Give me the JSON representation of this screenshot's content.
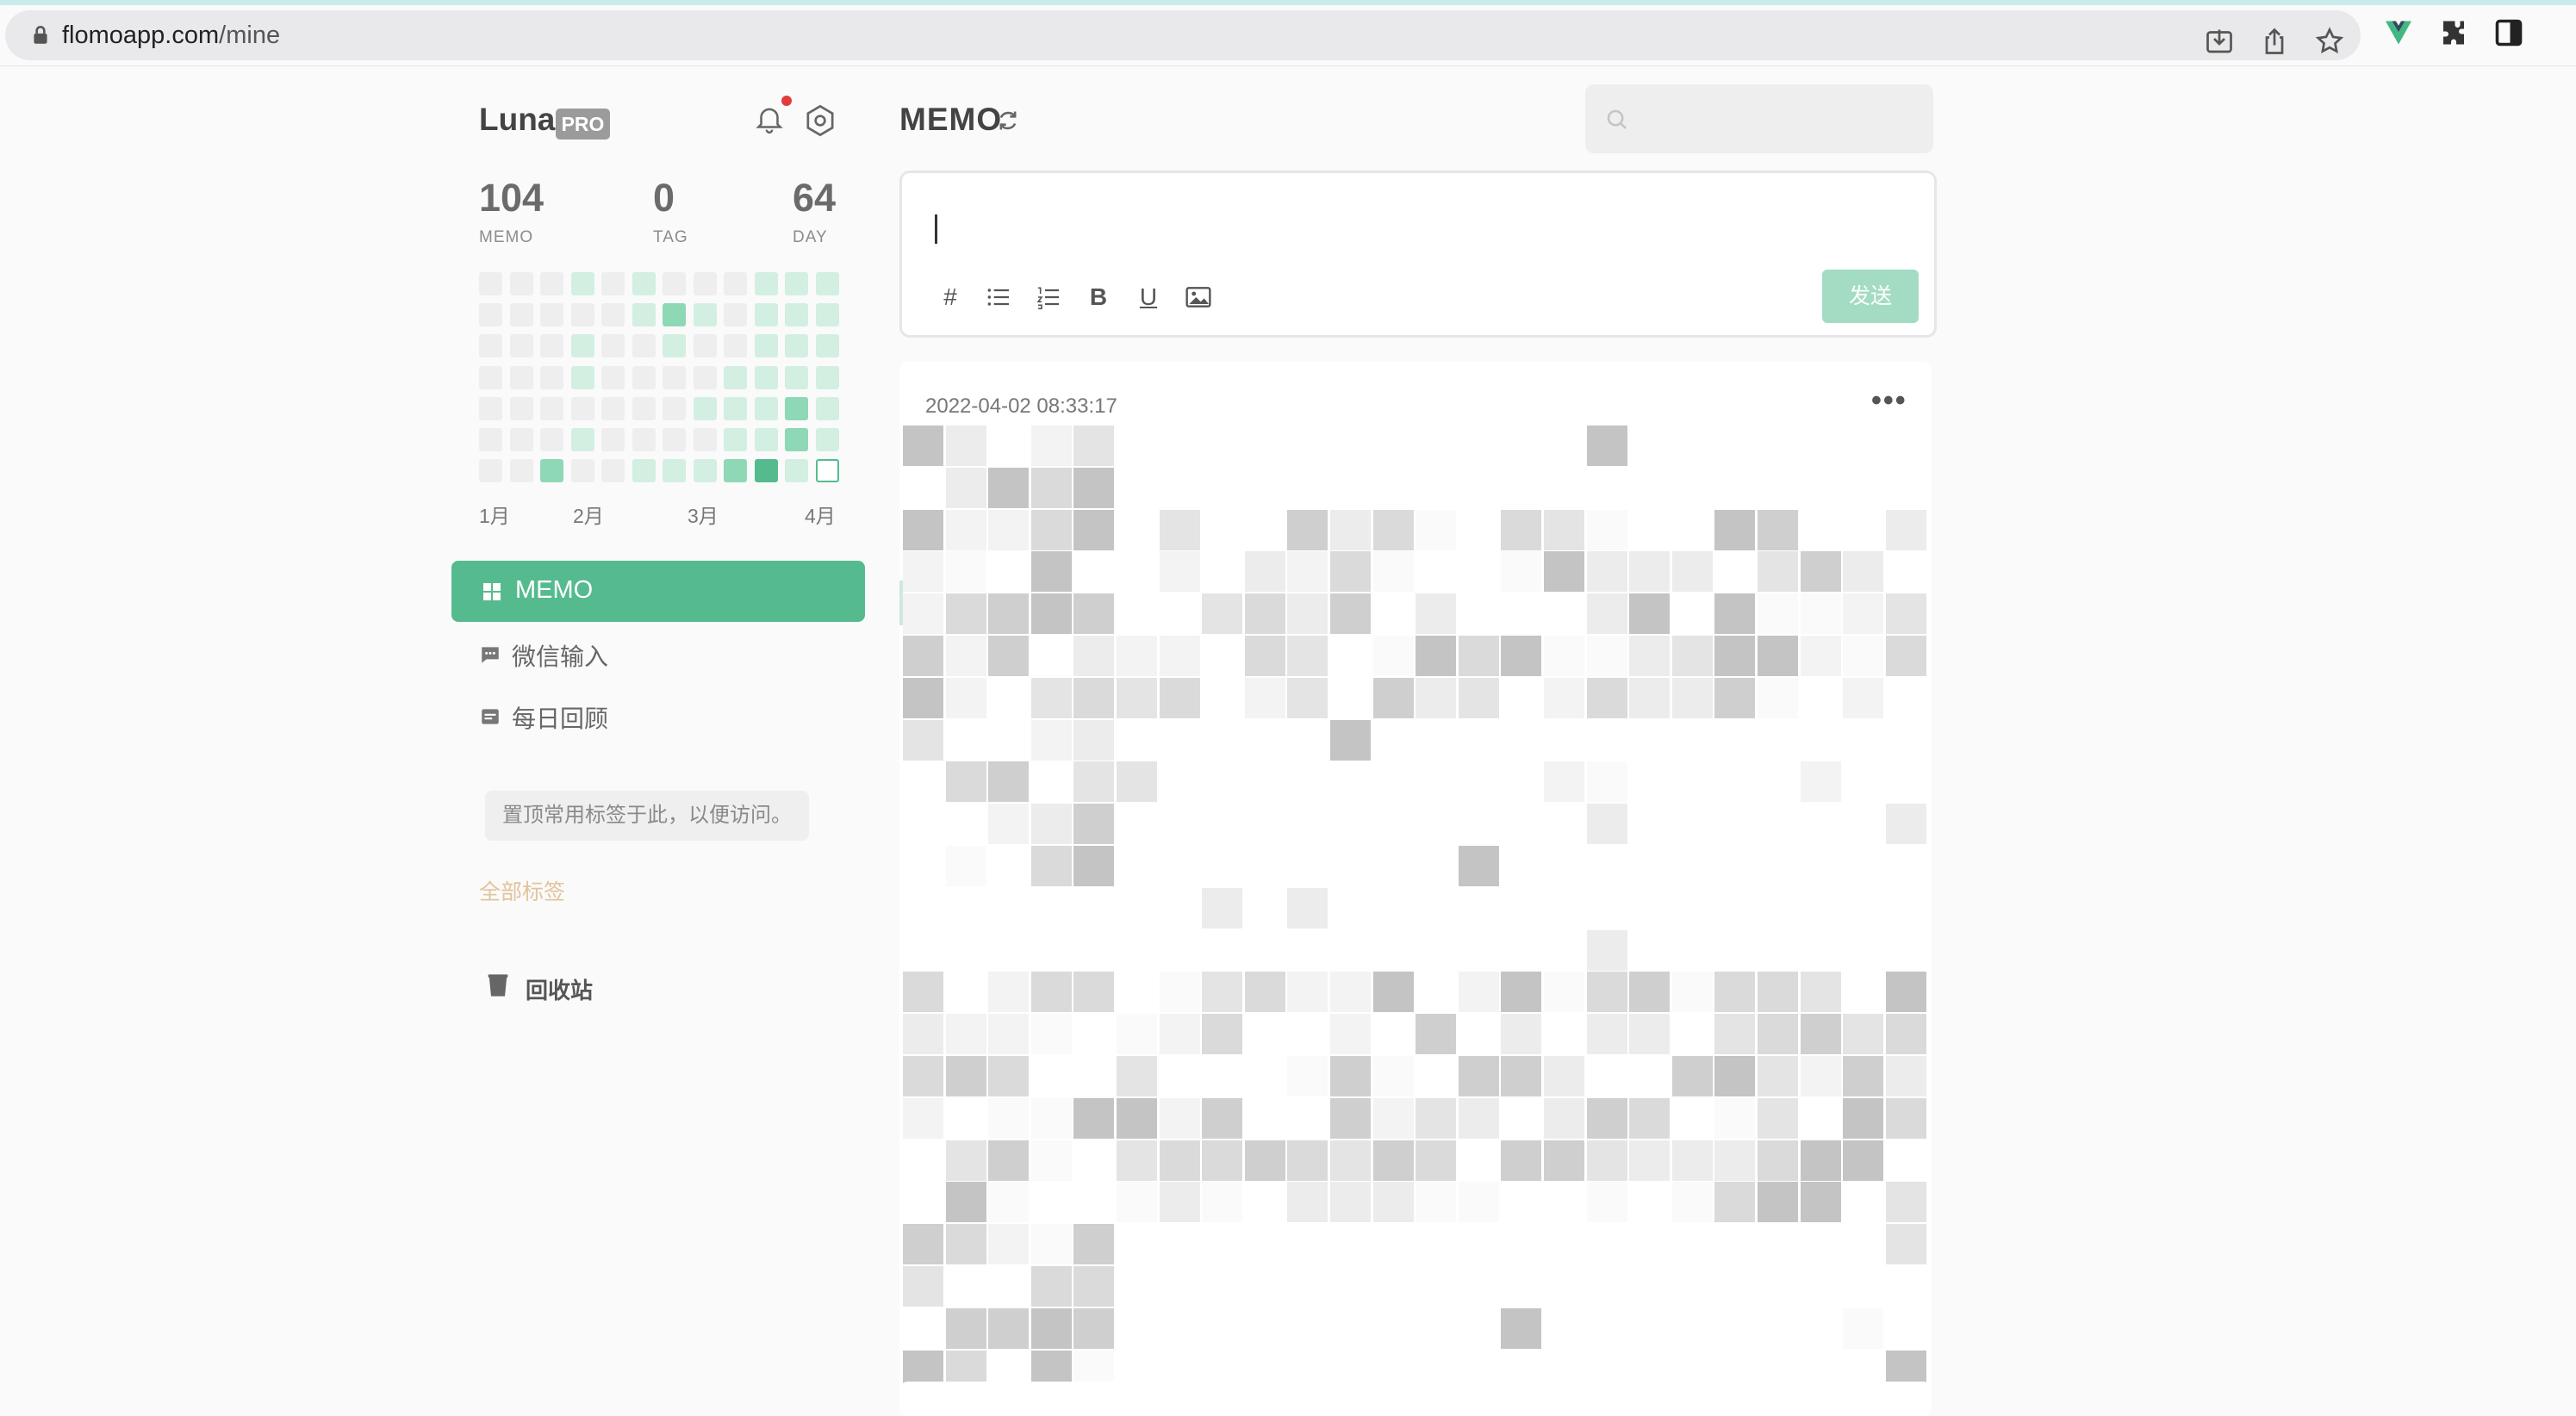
{
  "browser": {
    "url_host": "flomoapp.com",
    "url_path": "/mine",
    "icons": [
      "lock-icon",
      "install-icon",
      "share-icon",
      "bookmark-star-icon",
      "vue-devtools-icon",
      "extensions-puzzle-icon",
      "sidepanel-icon"
    ]
  },
  "sidebar": {
    "username": "Luna",
    "badge": "PRO",
    "stats": [
      {
        "value": "104",
        "label": "MEMO"
      },
      {
        "value": "0",
        "label": "TAG"
      },
      {
        "value": "64",
        "label": "DAY"
      }
    ],
    "heatmap": {
      "columns": 12,
      "rows": 7,
      "levels": [
        [
          0,
          0,
          0,
          1,
          0,
          1,
          0,
          0,
          0,
          1,
          1,
          1
        ],
        [
          0,
          0,
          0,
          0,
          0,
          1,
          2,
          1,
          0,
          1,
          1,
          1
        ],
        [
          0,
          0,
          0,
          1,
          0,
          0,
          1,
          0,
          0,
          1,
          1,
          1
        ],
        [
          0,
          0,
          0,
          1,
          0,
          0,
          0,
          0,
          1,
          1,
          1,
          1
        ],
        [
          0,
          0,
          0,
          0,
          0,
          0,
          0,
          1,
          1,
          1,
          2,
          1
        ],
        [
          0,
          0,
          0,
          1,
          0,
          0,
          0,
          0,
          1,
          1,
          2,
          1
        ],
        [
          0,
          0,
          2,
          0,
          0,
          1,
          1,
          1,
          2,
          3,
          1,
          -1
        ]
      ],
      "colors": {
        "empty": "#eeeeee",
        "l1": "#d3efe2",
        "l2": "#8fd8b5",
        "l3": "#55bb8e"
      }
    },
    "months": [
      "1月",
      "2月",
      "3月",
      "4月"
    ],
    "nav": {
      "memo": "MEMO",
      "wechat": "微信输入",
      "daily": "每日回顾"
    },
    "tag_hint": "置顶常用标签于此，以便访问。",
    "all_tags": "全部标签",
    "trash": "回收站"
  },
  "main": {
    "title": "MEMO",
    "search": {
      "placeholder": "",
      "value": ""
    },
    "editor": {
      "value": "",
      "tools": [
        "#",
        "bullet-list",
        "numbered-list",
        "B",
        "U",
        "image"
      ],
      "send": "发送"
    },
    "memos": [
      {
        "time": "2022-04-02 08:33:17",
        "more": "•••",
        "content": "[pixelated / redacted content]"
      }
    ]
  },
  "colors": {
    "accent": "#55bb8e",
    "send_disabled": "#a3dcc3",
    "notification": "#e23b3b",
    "tag_link": "#e2c49b"
  }
}
